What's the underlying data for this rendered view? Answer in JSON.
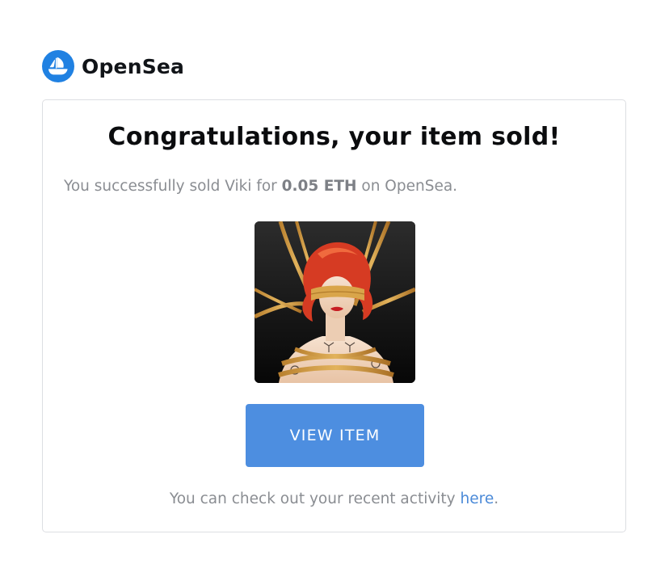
{
  "header": {
    "brand_name": "OpenSea",
    "logo_icon": "opensea-sailboat-icon",
    "logo_color": "#2081E2"
  },
  "email": {
    "headline": "Congratulations, your item sold!",
    "sold_prefix": "You successfully sold Viki for",
    "price": "0.05 ETH",
    "sold_suffix": "on OpenSea.",
    "item_image_icon": "nft-artwork-image",
    "button_label": "VIEW ITEM",
    "button_color": "#4D8EE0",
    "activity_prefix": "You can check out your recent activity",
    "activity_link": "here",
    "activity_suffix": ".",
    "link_color": "#4B8AD8"
  }
}
